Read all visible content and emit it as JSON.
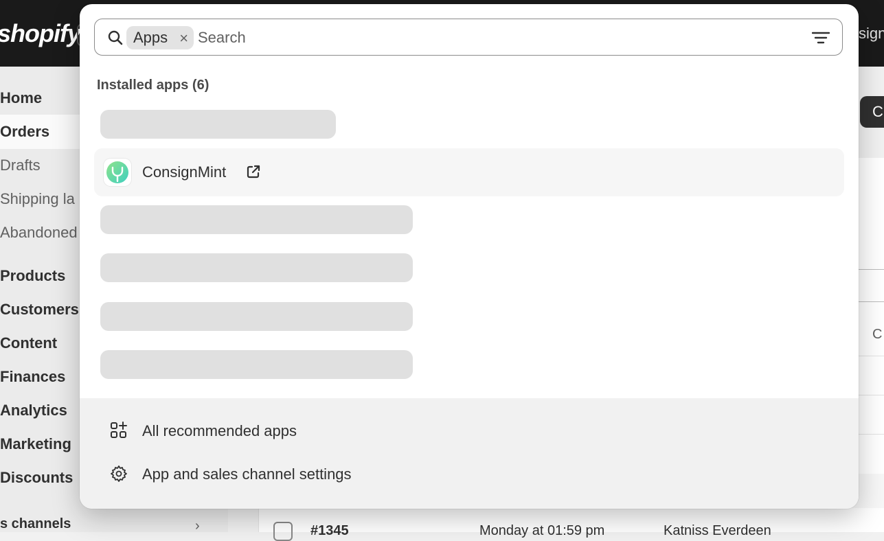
{
  "topbar": {
    "logo": "shopify",
    "right_text": "sign"
  },
  "sidebar": {
    "items": [
      {
        "label": "Home"
      },
      {
        "label": "Orders"
      },
      {
        "label": "Drafts"
      },
      {
        "label": "Shipping la"
      },
      {
        "label": "Abandoned"
      },
      {
        "label": "Products"
      },
      {
        "label": "Customers"
      },
      {
        "label": "Content"
      },
      {
        "label": "Finances"
      },
      {
        "label": "Analytics"
      },
      {
        "label": "Marketing"
      },
      {
        "label": "Discounts"
      },
      {
        "label": "s channels"
      }
    ]
  },
  "background": {
    "create_button": "C",
    "column_letter": "C",
    "order_row": {
      "number": "#1345",
      "date": "Monday at 01:59 pm",
      "customer": "Katniss Everdeen"
    }
  },
  "modal": {
    "search": {
      "chip_label": "Apps",
      "chip_close": "×",
      "placeholder": "Search",
      "value": ""
    },
    "section_title": "Installed apps (6)",
    "app": {
      "name": "ConsignMint"
    },
    "footer": {
      "recommended_label": "All recommended apps",
      "settings_label": "App and sales channel settings"
    }
  },
  "colors": {
    "topbar": "#1a1a1a",
    "skeleton": "#e0e0e0",
    "app_icon_gradient": [
      "#8ee28a",
      "#3fd0c0"
    ]
  },
  "icons": [
    "search-icon",
    "close-icon",
    "filter-icon",
    "external-link-icon",
    "apps-grid-icon",
    "gear-icon",
    "chevron-right-icon"
  ]
}
